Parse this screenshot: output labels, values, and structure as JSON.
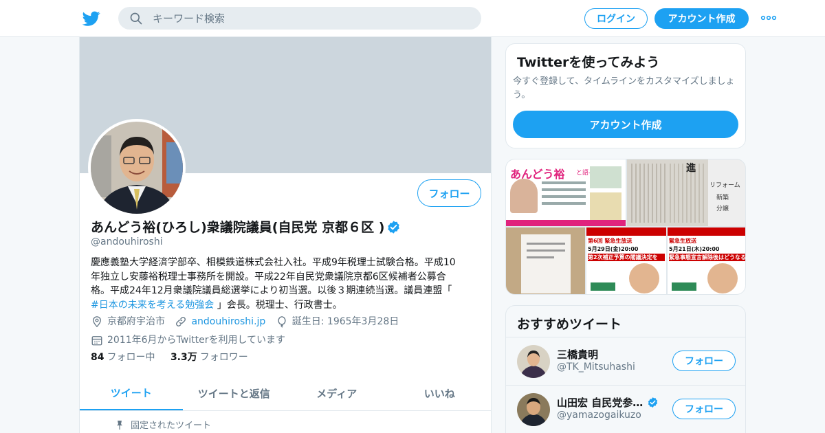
{
  "colors": {
    "accent": "#1da1f2",
    "link": "#1b95e0",
    "muted": "#657786",
    "text": "#14171a",
    "banner": "#ccd6dd"
  },
  "header": {
    "logo_icon": "twitter-bird-icon",
    "search": {
      "placeholder": "キーワード検索"
    },
    "login_label": "ログイン",
    "signup_label": "アカウント作成",
    "more_icon": "more-dots-icon"
  },
  "profile": {
    "name": "あんどう裕(ひろし)衆議院議員(自民党 京都６区 )",
    "handle": "@andouhiroshi",
    "follow_label": "フォロー",
    "bio_lines": [
      "慶應義塾大学経済学部卒、相模鉄道株式会社入社。平成9年税理士試験合格。平成10",
      "年独立し安藤裕税理士事務所を開設。平成22年自民党衆議院京都6区候補者公募合",
      "格。平成24年12月衆議院議員総選挙により初当選。以後３期連続当選。議員連盟「"
    ],
    "bio_hashtag": "#日本の未来を考える勉強会",
    "bio_tail": " 」会長。税理士、行政書士。",
    "location": "京都府宇治市",
    "website": "andouhiroshi.jp",
    "birthday": "誕生日: 1965年3月28日",
    "joined": "2011年6月からTwitterを利用しています",
    "following_count": "84",
    "following_label": "フォロー中",
    "followers_count": "3.3万",
    "followers_label": "フォロワー",
    "tabs": [
      "ツイート",
      "ツイートと返信",
      "メディア",
      "いいね"
    ],
    "pinned_label": "固定されたツイート"
  },
  "sidebar": {
    "try": {
      "title": "Twitterを使ってみよう",
      "text": "今すぐ登録して、タイムラインをカスタマイズしましょう。",
      "button": "アカウント作成"
    },
    "media_tiles": {
      "t1_title": "あんどう裕",
      "t1_sub": "と語る会",
      "t2_text": "進",
      "t2_side": "リフォーム",
      "t2_side2": "新築",
      "t2_side3": "分譲",
      "t4_head": "第6回 緊急生放送",
      "t4_date": "5月29日(金)20:00",
      "t4_line": "第2次補正予算の閣議決定を",
      "t5_head": "緊急生放送",
      "t5_date": "5月21日(木)20:00",
      "t5_line": "緊急事態宣言解除後はどうなるか"
    },
    "recommended": {
      "title": "おすすめツイート",
      "accounts": [
        {
          "name": "三橋貴明",
          "handle": "@TK_Mitsuhashi",
          "button": "フォロー"
        },
        {
          "name": "山田宏 自民党参…",
          "handle": "@yamazogaikuzo",
          "button": "フォロー"
        }
      ]
    }
  }
}
